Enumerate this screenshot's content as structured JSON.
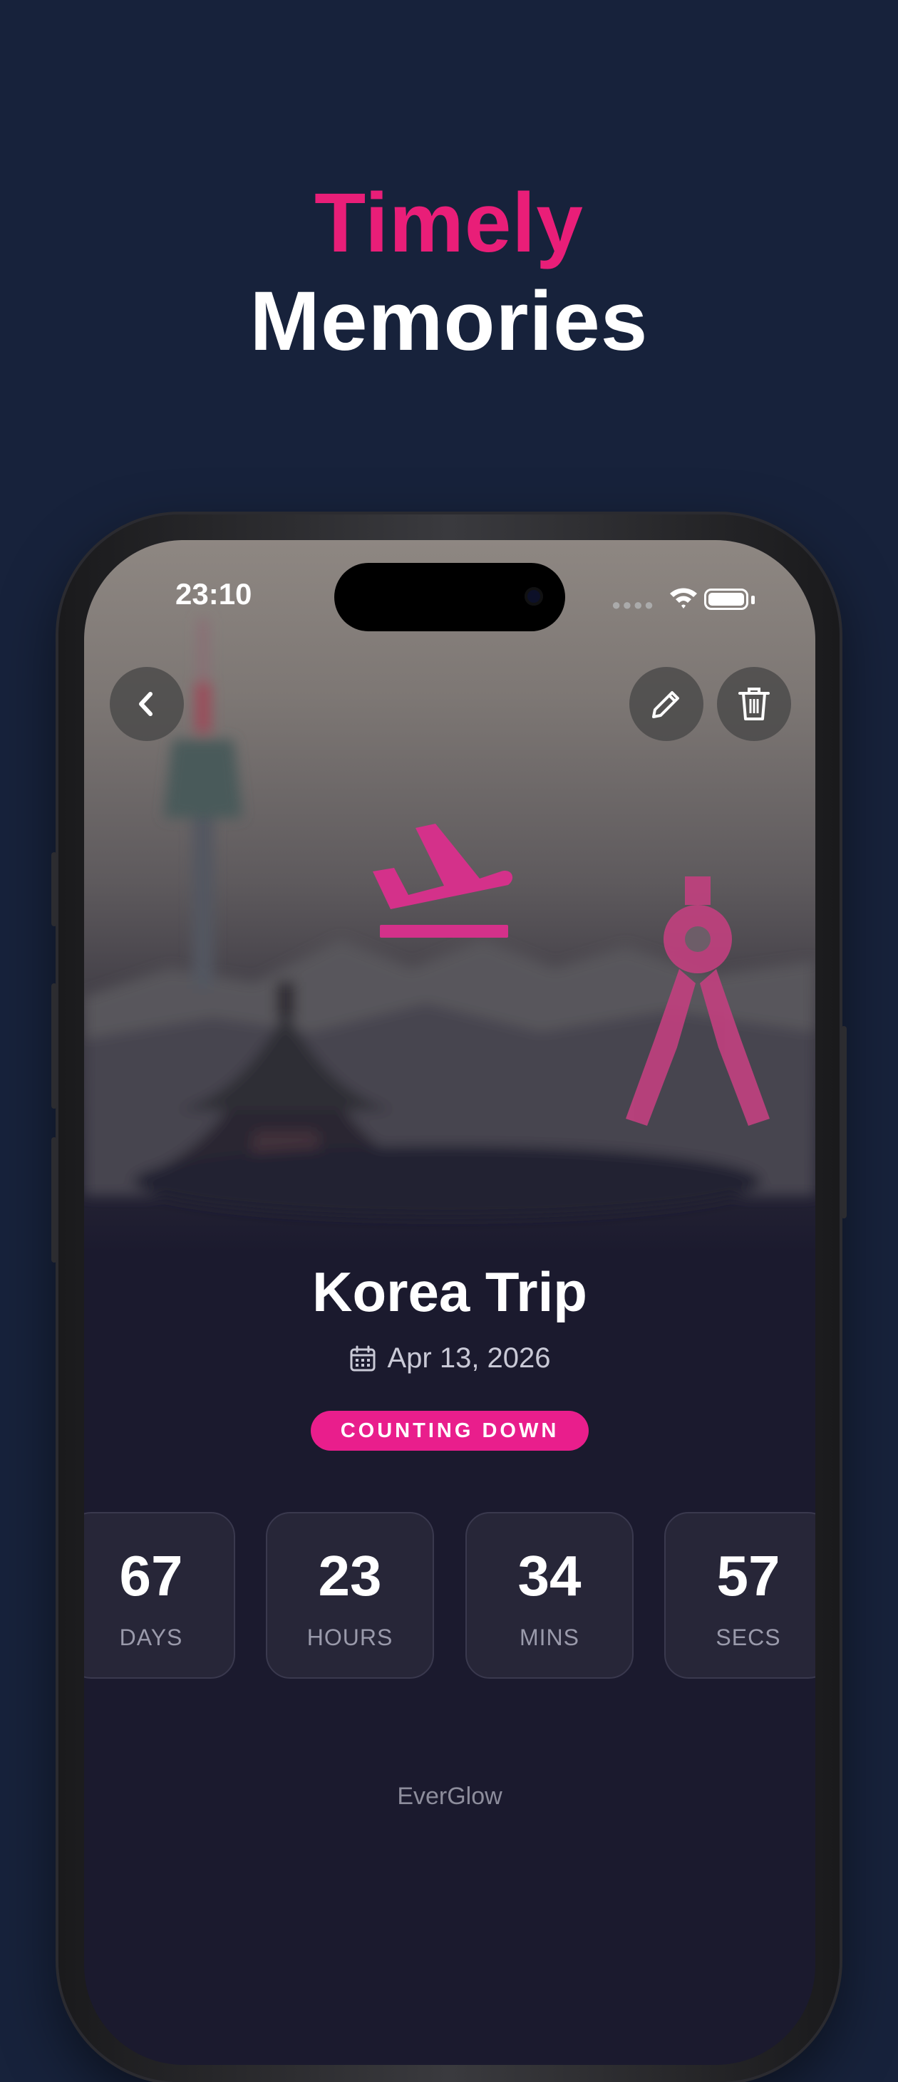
{
  "headline": {
    "line1": "Timely",
    "line2": "Memories"
  },
  "status_bar": {
    "time": "23:10"
  },
  "event": {
    "title": "Korea Trip",
    "date": "Apr 13, 2026",
    "status_badge": "COUNTING DOWN"
  },
  "countdown": [
    {
      "value": "67",
      "label": "DAYS"
    },
    {
      "value": "23",
      "label": "HOURS"
    },
    {
      "value": "34",
      "label": "MINS"
    },
    {
      "value": "57",
      "label": "SECS"
    }
  ],
  "footer": {
    "brand": "EverGlow"
  },
  "icons": {
    "back": "chevron-left-icon",
    "edit": "pencil-icon",
    "delete": "trash-icon",
    "flight": "airplane-takeoff-icon",
    "compass": "drafting-compass-icon",
    "calendar": "calendar-icon"
  },
  "colors": {
    "accent": "#e91e8c",
    "background": "#17223b",
    "screen": "#1b1a2e"
  }
}
